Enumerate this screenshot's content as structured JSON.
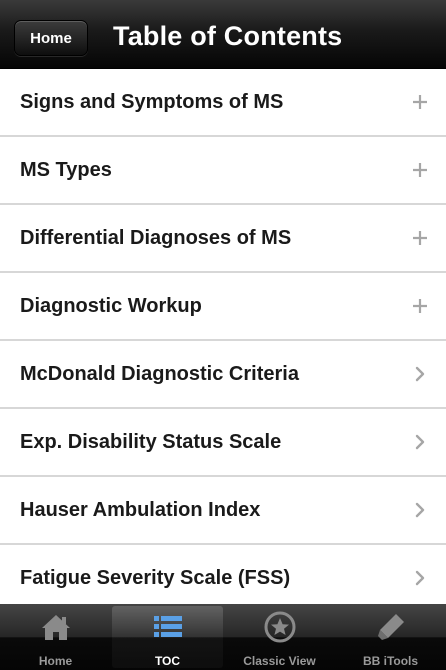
{
  "navbar": {
    "home_button": "Home",
    "title": "Table of Contents"
  },
  "list": {
    "items": [
      {
        "label": "Signs and Symptoms of MS",
        "icon": "plus-icon"
      },
      {
        "label": "MS Types",
        "icon": "plus-icon"
      },
      {
        "label": "Differential Diagnoses of MS",
        "icon": "plus-icon"
      },
      {
        "label": "Diagnostic Workup",
        "icon": "plus-icon"
      },
      {
        "label": "McDonald Diagnostic Criteria",
        "icon": "chevron-right-icon"
      },
      {
        "label": "Exp. Disability Status Scale",
        "icon": "chevron-right-icon"
      },
      {
        "label": "Hauser Ambulation Index",
        "icon": "chevron-right-icon"
      },
      {
        "label": "Fatigue Severity Scale (FSS)",
        "icon": "chevron-right-icon"
      }
    ]
  },
  "tabbar": {
    "selected": "TOC",
    "tabs": [
      {
        "label": "Home",
        "icon": "house-icon"
      },
      {
        "label": "TOC",
        "icon": "list-icon"
      },
      {
        "label": "Classic View",
        "icon": "star-circle-icon"
      },
      {
        "label": "BB iTools",
        "icon": "tool-icon"
      }
    ]
  },
  "colors": {
    "bar_dark": "#050505",
    "accent_blue": "#5aa0e6",
    "separator": "#d7d7d7",
    "row_text": "#1a1a1a",
    "disclosure": "#a6a6a6"
  }
}
